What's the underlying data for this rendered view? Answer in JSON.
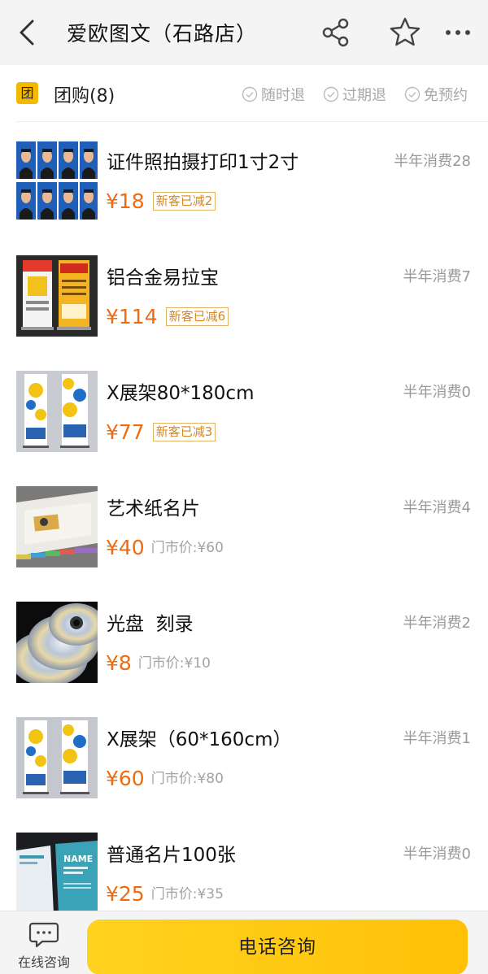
{
  "header": {
    "title": "爱欧图文（石路店）"
  },
  "group": {
    "badge": "团",
    "title": "团购(8)",
    "features": [
      "随时退",
      "过期退",
      "免预约"
    ]
  },
  "deals": [
    {
      "name": "证件照拍摄打印1寸2寸",
      "sold": "半年消费28",
      "price": "¥18",
      "tag": "新客已减2",
      "orig": ""
    },
    {
      "name": "铝合金易拉宝",
      "sold": "半年消费7",
      "price": "¥114",
      "tag": "新客已减6",
      "orig": ""
    },
    {
      "name": "X展架80*180cm",
      "sold": "半年消费0",
      "price": "¥77",
      "tag": "新客已减3",
      "orig": ""
    },
    {
      "name": "艺术纸名片",
      "sold": "半年消费4",
      "price": "¥40",
      "tag": "",
      "orig": "门市价:¥60"
    },
    {
      "name": "光盘  刻录",
      "sold": "半年消费2",
      "price": "¥8",
      "tag": "",
      "orig": "门市价:¥10"
    },
    {
      "name": "X展架（60*160cm）",
      "sold": "半年消费1",
      "price": "¥60",
      "tag": "",
      "orig": "门市价:¥80"
    },
    {
      "name": "普通名片100张",
      "sold": "半年消费0",
      "price": "¥25",
      "tag": "",
      "orig": "门市价:¥35"
    }
  ],
  "thumb_text": {
    "card": "NAME"
  },
  "bottom": {
    "consult_label": "在线咨询",
    "call_label": "电话咨询"
  },
  "colors": {
    "accent": "#ffc107",
    "price": "#f06b0f",
    "tag": "#d9871a"
  },
  "icons": [
    "back-icon",
    "share-icon",
    "star-icon",
    "more-icon",
    "check-circle-icon",
    "chat-icon"
  ]
}
